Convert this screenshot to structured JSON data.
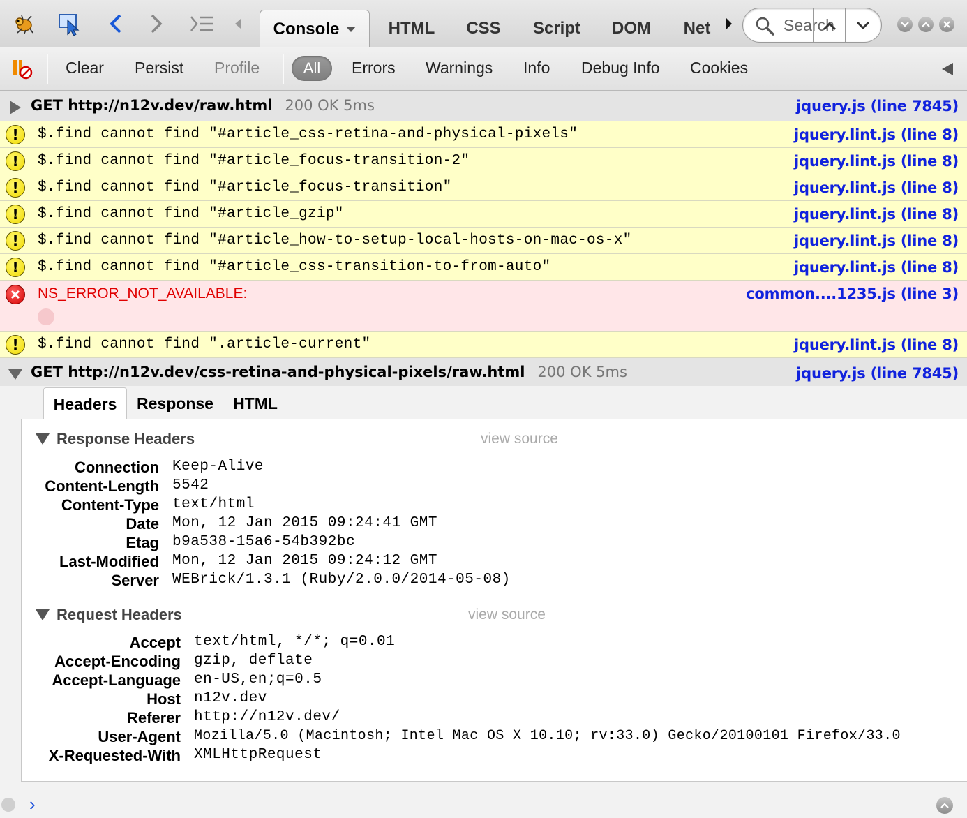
{
  "toolbar": {
    "icons": [
      "firebug-icon",
      "inspect-icon",
      "back-icon",
      "forward-icon",
      "command-list-icon",
      "tab-scroll-left-icon"
    ],
    "tabs": [
      {
        "label": "Console",
        "active": true,
        "has_menu": true
      },
      {
        "label": "HTML"
      },
      {
        "label": "CSS"
      },
      {
        "label": "Script"
      },
      {
        "label": "DOM"
      },
      {
        "label": "Net"
      }
    ],
    "search": {
      "placeholder": "Search",
      "value": ""
    }
  },
  "filterbar": {
    "clear": "Clear",
    "persist": "Persist",
    "profile": "Profile",
    "filters": [
      "All",
      "Errors",
      "Warnings",
      "Info",
      "Debug Info",
      "Cookies"
    ],
    "active_filter": "All"
  },
  "log": {
    "net1": {
      "method_url": "GET http://n12v.dev/raw.html",
      "status": "200 OK 5ms",
      "source": "jquery.js (line 7845)",
      "expanded": false
    },
    "warnings": [
      {
        "message": "$.find cannot find \"#article_css-retina-and-physical-pixels\"",
        "source": "jquery.lint.js (line 8)"
      },
      {
        "message": "$.find cannot find \"#article_focus-transition-2\"",
        "source": "jquery.lint.js (line 8)"
      },
      {
        "message": "$.find cannot find \"#article_focus-transition\"",
        "source": "jquery.lint.js (line 8)"
      },
      {
        "message": "$.find cannot find \"#article_gzip\"",
        "source": "jquery.lint.js (line 8)"
      },
      {
        "message": "$.find cannot find \"#article_how-to-setup-local-hosts-on-mac-os-x\"",
        "source": "jquery.lint.js (line 8)"
      },
      {
        "message": "$.find cannot find \"#article_css-transition-to-from-auto\"",
        "source": "jquery.lint.js (line 8)"
      }
    ],
    "error": {
      "message": "NS_ERROR_NOT_AVAILABLE:",
      "source": "common....1235.js (line 3)"
    },
    "warning_last": {
      "message": "$.find cannot find \".article-current\"",
      "source": "jquery.lint.js (line 8)"
    },
    "net2": {
      "method_url": "GET http://n12v.dev/css-retina-and-physical-pixels/raw.html",
      "status": "200 OK 5ms",
      "source": "jquery.js (line 7845)",
      "expanded": true
    }
  },
  "request": {
    "tabs": [
      "Headers",
      "Response",
      "HTML"
    ],
    "active_tab": "Headers",
    "view_source": "view source",
    "response_headers": {
      "title": "Response Headers",
      "rows": [
        {
          "name": "Connection",
          "value": "Keep-Alive"
        },
        {
          "name": "Content-Length",
          "value": "5542"
        },
        {
          "name": "Content-Type",
          "value": "text/html"
        },
        {
          "name": "Date",
          "value": "Mon, 12 Jan 2015 09:24:41 GMT"
        },
        {
          "name": "Etag",
          "value": "b9a538-15a6-54b392bc"
        },
        {
          "name": "Last-Modified",
          "value": "Mon, 12 Jan 2015 09:24:12 GMT"
        },
        {
          "name": "Server",
          "value": "WEBrick/1.3.1 (Ruby/2.0.0/2014-05-08)"
        }
      ]
    },
    "request_headers": {
      "title": "Request Headers",
      "rows": [
        {
          "name": "Accept",
          "value": "text/html, */*; q=0.01"
        },
        {
          "name": "Accept-Encoding",
          "value": "gzip, deflate"
        },
        {
          "name": "Accept-Language",
          "value": "en-US,en;q=0.5"
        },
        {
          "name": "Host",
          "value": "n12v.dev"
        },
        {
          "name": "Referer",
          "value": "http://n12v.dev/"
        },
        {
          "name": "User-Agent",
          "value": "Mozilla/5.0 (Macintosh; Intel Mac OS X 10.10; rv:33.0) Gecko/20100101 Firefox/33.0"
        },
        {
          "name": "X-Requested-With",
          "value": "XMLHttpRequest"
        }
      ]
    }
  },
  "command_line": {
    "prompt": "›",
    "value": ""
  },
  "colors": {
    "link": "#1122dd",
    "warning_bg": "#ffffc8",
    "error_bg": "#ffe6e8",
    "error_text": "#e00000"
  }
}
